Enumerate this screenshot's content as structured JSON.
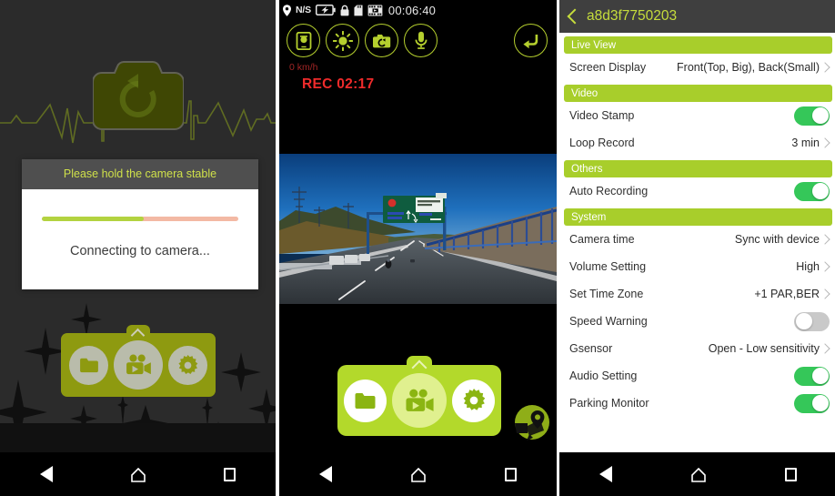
{
  "colors": {
    "lime": "#b3d92b",
    "sec_header_green": "#a8ce2b",
    "toggle_on": "#35c759",
    "toggle_off": "#c9c9c9",
    "accent_yellow_green": "#c6dd3c",
    "rec_red": "#ef2b2b",
    "dark_header": "#3f3f3f",
    "splash_bg": "#4a4a4a",
    "progress_fill": "#b3d340",
    "progress_track": "#f3b9a4"
  },
  "panel_connecting": {
    "logo_icon": "camera-refresh-icon",
    "dialog": {
      "title": "Please hold the camera stable",
      "message": "Connecting to camera...",
      "progress_percent": 52
    },
    "toolbar": [
      {
        "icon": "folder-icon",
        "label": "Files"
      },
      {
        "icon": "video-camera-icon",
        "label": "Live View"
      },
      {
        "icon": "gear-icon",
        "label": "Settings"
      }
    ],
    "expand_handle_icon": "chevron-up-icon"
  },
  "panel_liveview": {
    "status_bar": {
      "gps_icon": "location-pin-icon",
      "gps_value": "N/S",
      "battery_icon": "battery-charging-icon",
      "lock_icon": "lock-icon",
      "sdcard_icon": "sd-card-icon",
      "video_icon": "film-strip-icon",
      "time": "00:06:40"
    },
    "controls": [
      {
        "icon": "phone-snapshot-icon",
        "label": "Snapshot to phone"
      },
      {
        "icon": "brightness-icon",
        "label": "Brightness"
      },
      {
        "icon": "camera-switch-icon",
        "label": "Switch camera"
      },
      {
        "icon": "microphone-icon",
        "label": "Microphone"
      }
    ],
    "back_button": {
      "icon": "return-arrow-icon",
      "label": "Back"
    },
    "speed": "0 km/h",
    "recording": "REC 02:17",
    "video_preview": {
      "description": "Dashcam forward view of a highway with a green overhead direction sign, blue sky, guard rails and a motorcycle ahead"
    },
    "toolbar": [
      {
        "icon": "folder-icon",
        "label": "Files"
      },
      {
        "icon": "video-camera-icon",
        "label": "Live View"
      },
      {
        "icon": "gear-icon",
        "label": "Settings"
      }
    ],
    "expand_handle_icon": "chevron-up-icon",
    "gps_map_button": {
      "icon": "map-pin-icon",
      "label": "Map"
    }
  },
  "panel_settings": {
    "header": {
      "back_icon": "back-chevron-icon",
      "title": "a8d3f7750203"
    },
    "sections": [
      {
        "title": "Live View",
        "rows": [
          {
            "label": "Screen Display",
            "type": "value",
            "value": "Front(Top, Big), Back(Small)",
            "chevron": true
          }
        ]
      },
      {
        "title": "Video",
        "rows": [
          {
            "label": "Video Stamp",
            "type": "toggle",
            "value": "on"
          },
          {
            "label": "Loop Record",
            "type": "value",
            "value": "3 min",
            "chevron": true
          }
        ]
      },
      {
        "title": "Others",
        "rows": [
          {
            "label": "Auto Recording",
            "type": "toggle",
            "value": "on"
          }
        ]
      },
      {
        "title": "System",
        "rows": [
          {
            "label": "Camera time",
            "type": "value",
            "value": "Sync with device",
            "chevron": true
          },
          {
            "label": "Volume Setting",
            "type": "value",
            "value": "High",
            "chevron": true
          },
          {
            "label": "Set Time Zone",
            "type": "value",
            "value": "+1 PAR,BER",
            "chevron": true
          },
          {
            "label": "Speed Warning",
            "type": "toggle",
            "value": "off"
          },
          {
            "label": "Gsensor",
            "type": "value",
            "value": "Open - Low sensitivity",
            "chevron": true
          },
          {
            "label": "Audio Setting",
            "type": "toggle",
            "value": "on"
          },
          {
            "label": "Parking Monitor",
            "type": "toggle",
            "value": "on"
          }
        ]
      }
    ]
  },
  "navbar": {
    "back": {
      "icon": "back-triangle-icon",
      "label": "Back"
    },
    "home": {
      "icon": "home-icon",
      "label": "Home"
    },
    "recents": {
      "icon": "square-recents-icon",
      "label": "Recents"
    }
  }
}
